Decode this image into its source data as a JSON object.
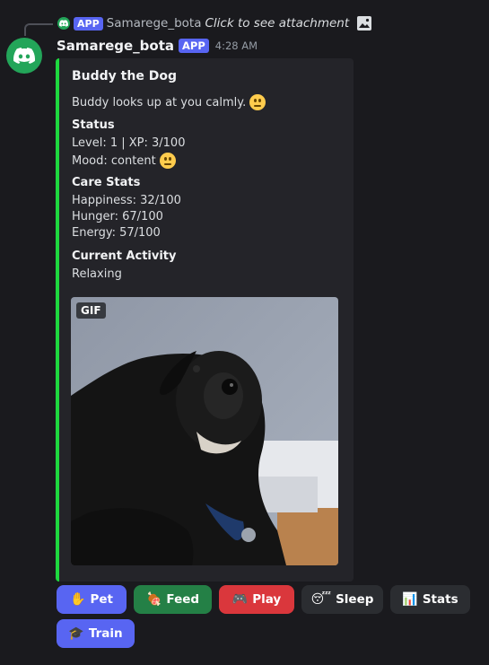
{
  "reply": {
    "badge": "APP",
    "author": "Samarege_bota",
    "text": "Click to see attachment"
  },
  "message": {
    "author": "Samarege_bota",
    "badge": "APP",
    "timestamp": "4:28 AM"
  },
  "embed": {
    "accent_color": "#1ed83f",
    "title": "Buddy the Dog",
    "description": "Buddy looks up at you calmly.",
    "fields": {
      "status": {
        "name": "Status",
        "level_line": "Level: 1 | XP: 3/100",
        "mood_line": "Mood: content"
      },
      "care": {
        "name": "Care Stats",
        "happiness": "Happiness: 32/100",
        "hunger": "Hunger: 67/100",
        "energy": "Energy: 57/100"
      },
      "activity": {
        "name": "Current Activity",
        "value": "Relaxing"
      }
    },
    "image": {
      "badge": "GIF"
    }
  },
  "buttons": [
    {
      "label": "Pet",
      "icon": "raised-hand-icon",
      "color": "#5865f2"
    },
    {
      "label": "Feed",
      "icon": "meat-on-bone-icon",
      "color": "#248046"
    },
    {
      "label": "Play",
      "icon": "game-controller-icon",
      "color": "#da373c"
    },
    {
      "label": "Sleep",
      "icon": "sleeping-face-icon",
      "color": "#2b2d31"
    },
    {
      "label": "Stats",
      "icon": "bar-chart-icon",
      "color": "#2b2d31"
    },
    {
      "label": "Train",
      "icon": "graduation-cap-icon",
      "color": "#5865f2"
    }
  ]
}
